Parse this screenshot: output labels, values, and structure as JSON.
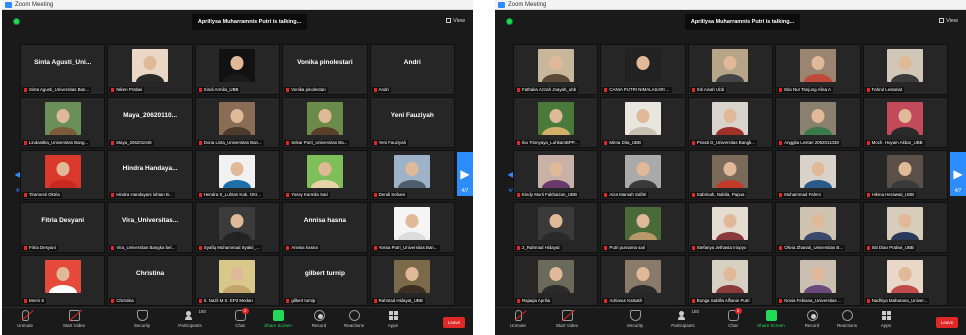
{
  "windows": [
    {
      "title": "Zoom Meeting",
      "banner": "Aprillysa Muharramnis Putri is talking...",
      "view_label": "View",
      "page_indicator": "4/7",
      "tiles": [
        {
          "kind": "name",
          "big": "Sinta Agusti_Uni...",
          "label": "Sinta Agusti_Universitas Ban..."
        },
        {
          "kind": "photo",
          "bg": "#ead7c5",
          "body": "#2a2a2a",
          "label": "Niken Pratiwi"
        },
        {
          "kind": "photo",
          "bg": "#111111",
          "body": "#1a1a1a",
          "label": "Sindi Armila_UBB"
        },
        {
          "kind": "name",
          "big": "Vonika pinolestari",
          "label": "Vonika pinolestari"
        },
        {
          "kind": "name",
          "big": "Andri",
          "label": "Andri"
        },
        {
          "kind": "photo",
          "bg": "#6a8f59",
          "body": "#7b5b3c",
          "label": "Lindastika_Universitas Bang..."
        },
        {
          "kind": "name",
          "big": "Maya_20620110...",
          "label": "Maya_206201048"
        },
        {
          "kind": "photo",
          "bg": "#8a6d55",
          "body": "#4c3a2a",
          "label": "Dona Lista_Universitas Ban..."
        },
        {
          "kind": "photo",
          "bg": "#6b8b4a",
          "body": "#5a3e2a",
          "label": "Sekar Putri_Universitas Ba..."
        },
        {
          "kind": "name",
          "big": "Yeni Fauziyah",
          "label": "Yeni Fauziyah"
        },
        {
          "kind": "photo",
          "bg": "#d9382b",
          "body": "#c42a21",
          "label": "Tiramesti Oktria"
        },
        {
          "kind": "name",
          "big": "Hindra Handaya...",
          "label": "Hindra Handayani luhtan B..."
        },
        {
          "kind": "photo",
          "bg": "#f1f1f1",
          "body": "#1e6ea8",
          "label": "Hendra S_Luhtan Kab. OKI..."
        },
        {
          "kind": "photo",
          "bg": "#7fbf5a",
          "body": "#e8d3a6",
          "label": "Yossy Karmila Sari"
        },
        {
          "kind": "photo",
          "bg": "#9fb3c8",
          "body": "#4d5d6b",
          "label": "Dendi Sebani"
        },
        {
          "kind": "name",
          "big": "Fitria Desyani",
          "label": "Fitria Desyani"
        },
        {
          "kind": "name",
          "big": "Vira_Universitas...",
          "label": "Vira_Universitas Bangka bel..."
        },
        {
          "kind": "photo",
          "bg": "#3b3b3b",
          "body": "#222222",
          "label": "Syafiq Muhammad Syakir_..."
        },
        {
          "kind": "name",
          "big": "Annisa hasna",
          "label": "Annisa hasna"
        },
        {
          "kind": "photo",
          "bg": "#f5f5f5",
          "body": "#dddddd",
          "label": "Yossa Putri_Universitas Ban..."
        },
        {
          "kind": "photo",
          "bg": "#e64a3a",
          "body": "#ffffff",
          "label": "Merni S"
        },
        {
          "kind": "name",
          "big": "Christina",
          "label": "Christina"
        },
        {
          "kind": "photo",
          "bg": "#d8c88a",
          "body": "#c3a46a",
          "label": "Ir. Nazli M.S. EP3 Medan"
        },
        {
          "kind": "name",
          "big": "gilbert turnip",
          "label": "gilbert turnip"
        },
        {
          "kind": "photo",
          "bg": "#7a6a4a",
          "body": "#3a2e22",
          "label": "Rahmad Hidayat_UBB"
        }
      ]
    },
    {
      "title": "Zoom Meeting",
      "banner": "Aprillysa Muharramnis Putri is talking...",
      "view_label": "View",
      "page_indicator": "4/7",
      "tiles": [
        {
          "kind": "photo",
          "bg": "#c9b79b",
          "body": "#5a4a3a",
          "label": "Fathaka Azzah Jnayah_ubb"
        },
        {
          "kind": "photo",
          "bg": "#222222",
          "body": "#222222",
          "label": "CANIA PUTRI NIMALASARI ..."
        },
        {
          "kind": "photo",
          "bg": "#b7a58a",
          "body": "#444444",
          "label": "Siti Aisah Ubb"
        },
        {
          "kind": "photo",
          "bg": "#9b8470",
          "body": "#c04a3a",
          "label": "Eka Nur Tanjung Alisa A"
        },
        {
          "kind": "photo",
          "bg": "#d0c7b8",
          "body": "#3b3b3b",
          "label": "Fahrul Lestariat"
        },
        {
          "kind": "photo",
          "bg": "#4a7a3a",
          "body": "#d1b06a",
          "label": "Ika Trisnyaya_LuhkamBPP..."
        },
        {
          "kind": "photo",
          "bg": "#e9e6df",
          "body": "#c8c0b0",
          "label": "Mirna Dita_UBB"
        },
        {
          "kind": "photo",
          "bg": "#d8d3cb",
          "body": "#a0302a",
          "label": "Priasti D_Universitas Bangk..."
        },
        {
          "kind": "photo",
          "bg": "#8a8070",
          "body": "#3a7a4a",
          "label": "Anggita Lestari 2062011038"
        },
        {
          "kind": "photo",
          "bg": "#c24a5a",
          "body": "#2a2a2a",
          "label": "Moch. Hoyam Akbar_UBB"
        },
        {
          "kind": "photo",
          "bg": "#c8b2a8",
          "body": "#6a3a6a",
          "label": "Eindy Murti Fakhaizan_UBB"
        },
        {
          "kind": "photo",
          "bg": "#aaaaaa",
          "body": "#3a3a3a",
          "label": "Aiza Marsah Safitri"
        },
        {
          "kind": "photo",
          "bg": "#7a6a5a",
          "body": "#c23a2a",
          "label": "Sabrinah, Nabila, Papua"
        },
        {
          "kind": "photo",
          "bg": "#d8d2c8",
          "body": "#2a5a8a",
          "label": "Muhammad Fahmi"
        },
        {
          "kind": "photo",
          "bg": "#5a5048",
          "body": "#3a3a3a",
          "label": "Hikma Herawati_UBB"
        },
        {
          "kind": "photo",
          "bg": "#3a3a3a",
          "body": "#2a2a2a",
          "label": "2_Rahmad Hidayat"
        },
        {
          "kind": "photo",
          "bg": "#4a6a3a",
          "body": "#b89a6a",
          "label": "Putri purnama sari"
        },
        {
          "kind": "photo",
          "bg": "#e4ddd0",
          "body": "#8a3a3a",
          "label": "Stefanya Jethasta Iriopyo"
        },
        {
          "kind": "photo",
          "bg": "#cfc3b2",
          "body": "#3a4a6a",
          "label": "Olivia Zhanati_Universitas B..."
        },
        {
          "kind": "photo",
          "bg": "#d8cdbb",
          "body": "#2a3a5a",
          "label": "Siti Dian Pratiwi_UBB"
        },
        {
          "kind": "photo",
          "bg": "#6a6a5a",
          "body": "#2a2a2a",
          "label": "Rajaqia Aprilia"
        },
        {
          "kind": "photo",
          "bg": "#8a7a6a",
          "body": "#2a2a2a",
          "label": "Adrianur Katsath"
        },
        {
          "kind": "photo",
          "bg": "#d9d0c4",
          "body": "#8a3a3a",
          "label": "Bunga Sabilla Alfianie Putri"
        },
        {
          "kind": "photo",
          "bg": "#cabfb0",
          "body": "#6a4a7a",
          "label": "Novia Febiana_Universitas ..."
        },
        {
          "kind": "photo",
          "bg": "#e9d8c8",
          "body": "#c24a4a",
          "label": "Nadhiya Maharana_Univer..."
        }
      ]
    }
  ],
  "toolbar": {
    "unmute": "Unmute",
    "start_video": "Start Video",
    "security": "Security",
    "participants": "Participants",
    "participants_count": "180",
    "chat": "Chat",
    "chat_badge": "3",
    "share_screen": "Share Screen",
    "record": "Record",
    "reactions": "Reactions",
    "apps": "Apps",
    "leave": "Leave"
  }
}
